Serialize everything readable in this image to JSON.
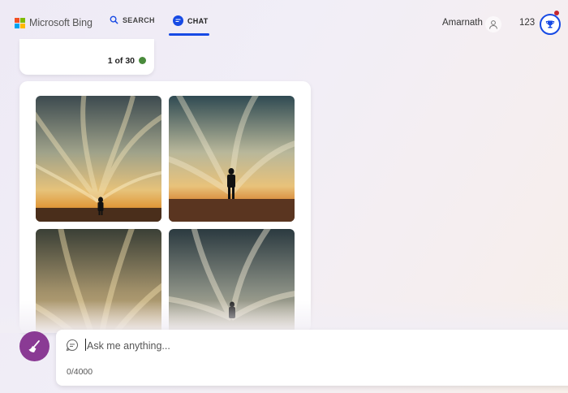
{
  "header": {
    "brand": "Microsoft Bing",
    "tabs": [
      {
        "label": "SEARCH",
        "icon": "search-icon"
      },
      {
        "label": "CHAT",
        "icon": "chat-icon",
        "active": true
      }
    ],
    "user_name": "Amarnath",
    "rewards_points": "123"
  },
  "counter": {
    "text": "1 of 30",
    "status_color": "#4a8b3c"
  },
  "images": [
    {
      "name": "silhouette-sunset-1"
    },
    {
      "name": "silhouette-sunset-2"
    },
    {
      "name": "silhouette-sky-3"
    },
    {
      "name": "silhouette-sky-4"
    }
  ],
  "composer": {
    "placeholder": "Ask me anything...",
    "char_count": "0/4000"
  },
  "colors": {
    "accent": "#174ae4",
    "broom": "#8a3a94"
  }
}
